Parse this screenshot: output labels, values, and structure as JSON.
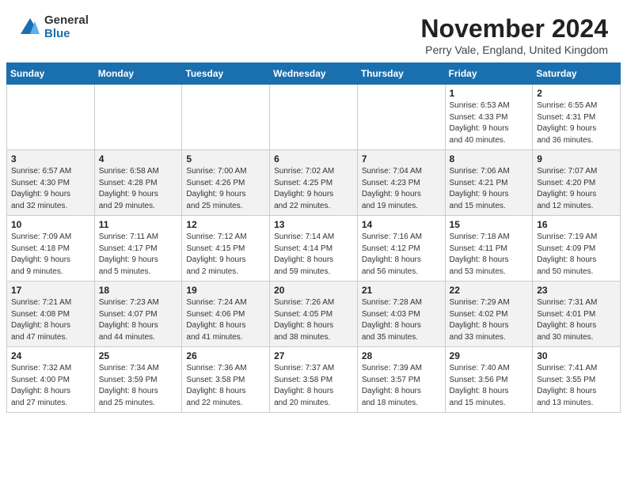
{
  "logo": {
    "general": "General",
    "blue": "Blue"
  },
  "title": "November 2024",
  "location": "Perry Vale, England, United Kingdom",
  "days_of_week": [
    "Sunday",
    "Monday",
    "Tuesday",
    "Wednesday",
    "Thursday",
    "Friday",
    "Saturday"
  ],
  "weeks": [
    [
      {
        "day": "",
        "info": ""
      },
      {
        "day": "",
        "info": ""
      },
      {
        "day": "",
        "info": ""
      },
      {
        "day": "",
        "info": ""
      },
      {
        "day": "",
        "info": ""
      },
      {
        "day": "1",
        "info": "Sunrise: 6:53 AM\nSunset: 4:33 PM\nDaylight: 9 hours\nand 40 minutes."
      },
      {
        "day": "2",
        "info": "Sunrise: 6:55 AM\nSunset: 4:31 PM\nDaylight: 9 hours\nand 36 minutes."
      }
    ],
    [
      {
        "day": "3",
        "info": "Sunrise: 6:57 AM\nSunset: 4:30 PM\nDaylight: 9 hours\nand 32 minutes."
      },
      {
        "day": "4",
        "info": "Sunrise: 6:58 AM\nSunset: 4:28 PM\nDaylight: 9 hours\nand 29 minutes."
      },
      {
        "day": "5",
        "info": "Sunrise: 7:00 AM\nSunset: 4:26 PM\nDaylight: 9 hours\nand 25 minutes."
      },
      {
        "day": "6",
        "info": "Sunrise: 7:02 AM\nSunset: 4:25 PM\nDaylight: 9 hours\nand 22 minutes."
      },
      {
        "day": "7",
        "info": "Sunrise: 7:04 AM\nSunset: 4:23 PM\nDaylight: 9 hours\nand 19 minutes."
      },
      {
        "day": "8",
        "info": "Sunrise: 7:06 AM\nSunset: 4:21 PM\nDaylight: 9 hours\nand 15 minutes."
      },
      {
        "day": "9",
        "info": "Sunrise: 7:07 AM\nSunset: 4:20 PM\nDaylight: 9 hours\nand 12 minutes."
      }
    ],
    [
      {
        "day": "10",
        "info": "Sunrise: 7:09 AM\nSunset: 4:18 PM\nDaylight: 9 hours\nand 9 minutes."
      },
      {
        "day": "11",
        "info": "Sunrise: 7:11 AM\nSunset: 4:17 PM\nDaylight: 9 hours\nand 5 minutes."
      },
      {
        "day": "12",
        "info": "Sunrise: 7:12 AM\nSunset: 4:15 PM\nDaylight: 9 hours\nand 2 minutes."
      },
      {
        "day": "13",
        "info": "Sunrise: 7:14 AM\nSunset: 4:14 PM\nDaylight: 8 hours\nand 59 minutes."
      },
      {
        "day": "14",
        "info": "Sunrise: 7:16 AM\nSunset: 4:12 PM\nDaylight: 8 hours\nand 56 minutes."
      },
      {
        "day": "15",
        "info": "Sunrise: 7:18 AM\nSunset: 4:11 PM\nDaylight: 8 hours\nand 53 minutes."
      },
      {
        "day": "16",
        "info": "Sunrise: 7:19 AM\nSunset: 4:09 PM\nDaylight: 8 hours\nand 50 minutes."
      }
    ],
    [
      {
        "day": "17",
        "info": "Sunrise: 7:21 AM\nSunset: 4:08 PM\nDaylight: 8 hours\nand 47 minutes."
      },
      {
        "day": "18",
        "info": "Sunrise: 7:23 AM\nSunset: 4:07 PM\nDaylight: 8 hours\nand 44 minutes."
      },
      {
        "day": "19",
        "info": "Sunrise: 7:24 AM\nSunset: 4:06 PM\nDaylight: 8 hours\nand 41 minutes."
      },
      {
        "day": "20",
        "info": "Sunrise: 7:26 AM\nSunset: 4:05 PM\nDaylight: 8 hours\nand 38 minutes."
      },
      {
        "day": "21",
        "info": "Sunrise: 7:28 AM\nSunset: 4:03 PM\nDaylight: 8 hours\nand 35 minutes."
      },
      {
        "day": "22",
        "info": "Sunrise: 7:29 AM\nSunset: 4:02 PM\nDaylight: 8 hours\nand 33 minutes."
      },
      {
        "day": "23",
        "info": "Sunrise: 7:31 AM\nSunset: 4:01 PM\nDaylight: 8 hours\nand 30 minutes."
      }
    ],
    [
      {
        "day": "24",
        "info": "Sunrise: 7:32 AM\nSunset: 4:00 PM\nDaylight: 8 hours\nand 27 minutes."
      },
      {
        "day": "25",
        "info": "Sunrise: 7:34 AM\nSunset: 3:59 PM\nDaylight: 8 hours\nand 25 minutes."
      },
      {
        "day": "26",
        "info": "Sunrise: 7:36 AM\nSunset: 3:58 PM\nDaylight: 8 hours\nand 22 minutes."
      },
      {
        "day": "27",
        "info": "Sunrise: 7:37 AM\nSunset: 3:58 PM\nDaylight: 8 hours\nand 20 minutes."
      },
      {
        "day": "28",
        "info": "Sunrise: 7:39 AM\nSunset: 3:57 PM\nDaylight: 8 hours\nand 18 minutes."
      },
      {
        "day": "29",
        "info": "Sunrise: 7:40 AM\nSunset: 3:56 PM\nDaylight: 8 hours\nand 15 minutes."
      },
      {
        "day": "30",
        "info": "Sunrise: 7:41 AM\nSunset: 3:55 PM\nDaylight: 8 hours\nand 13 minutes."
      }
    ]
  ]
}
